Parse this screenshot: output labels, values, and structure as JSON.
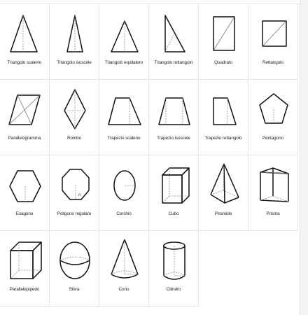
{
  "shapes": [
    {
      "label": "Triangolo scaleno",
      "icon": "scalene-triangle-icon"
    },
    {
      "label": "Triangolo isoscele",
      "icon": "isosceles-triangle-icon"
    },
    {
      "label": "Triangolo equilatero",
      "icon": "equilateral-triangle-icon"
    },
    {
      "label": "Triangolo rettangolo",
      "icon": "right-triangle-icon"
    },
    {
      "label": "Quadrato",
      "icon": "square-icon"
    },
    {
      "label": "Rettangolo",
      "icon": "rectangle-icon"
    },
    {
      "label": "Parallelogramma",
      "icon": "parallelogram-icon"
    },
    {
      "label": "Rombo",
      "icon": "rhombus-icon"
    },
    {
      "label": "Trapezio scaleno",
      "icon": "scalene-trapezoid-icon"
    },
    {
      "label": "Trapezio isoscele",
      "icon": "isosceles-trapezoid-icon"
    },
    {
      "label": "Trapezio rettangolo",
      "icon": "right-trapezoid-icon"
    },
    {
      "label": "Pentagono",
      "icon": "pentagon-icon"
    },
    {
      "label": "Esagono",
      "icon": "hexagon-icon"
    },
    {
      "label": "Poligono regolare",
      "icon": "regular-polygon-icon",
      "glyph": "n"
    },
    {
      "label": "Cerchio",
      "icon": "circle-icon"
    },
    {
      "label": "Cubo",
      "icon": "cube-icon"
    },
    {
      "label": "Piramide",
      "icon": "pyramid-icon"
    },
    {
      "label": "Prisma",
      "icon": "prism-icon"
    },
    {
      "label": "Parallelepipedo",
      "icon": "cuboid-icon"
    },
    {
      "label": "Sfera",
      "icon": "sphere-icon"
    },
    {
      "label": "Cono",
      "icon": "cone-icon"
    },
    {
      "label": "Cilindro",
      "icon": "cylinder-icon"
    }
  ]
}
